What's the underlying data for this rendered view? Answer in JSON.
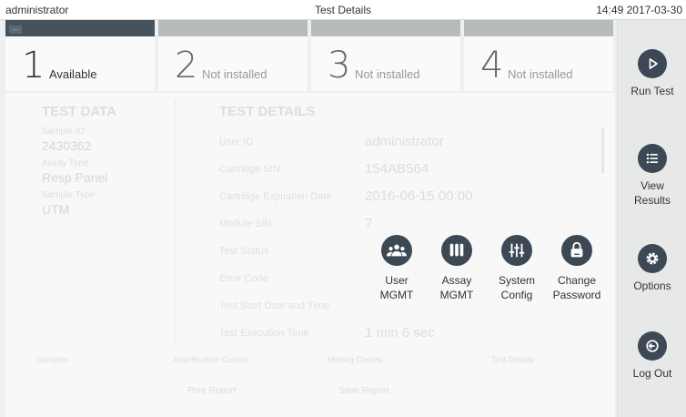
{
  "topbar": {
    "user": "administrator",
    "title": "Test Details",
    "datetime": "14:49 2017-03-30"
  },
  "modules": [
    {
      "number": "1",
      "label": "Available",
      "active": true
    },
    {
      "number": "2",
      "label": "Not installed",
      "active": false
    },
    {
      "number": "3",
      "label": "Not installed",
      "active": false
    },
    {
      "number": "4",
      "label": "Not installed",
      "active": false
    }
  ],
  "test_data": {
    "heading": "TEST DATA",
    "fields": [
      {
        "key": "Sample ID",
        "value": "2430362"
      },
      {
        "key": "Assay Type",
        "value": "Resp Panel"
      },
      {
        "key": "Sample Type",
        "value": "UTM"
      }
    ]
  },
  "test_details": {
    "heading": "TEST DETAILS",
    "rows": [
      {
        "key": "User ID",
        "value": "administrator"
      },
      {
        "key": "Cartridge S/N",
        "value": "154AB564"
      },
      {
        "key": "Cartridge Expiration Date",
        "value": "2016-06-15 00:00"
      },
      {
        "key": "Module S/N",
        "value": "7"
      },
      {
        "key": "Test Status",
        "value": ""
      },
      {
        "key": "Error Code",
        "value": ""
      },
      {
        "key": "Test Start Date and Time",
        "value": ""
      },
      {
        "key": "Test Execution Time",
        "value": "1 min 6 sec"
      }
    ]
  },
  "tabs": [
    "Samples",
    "Amplification Curves",
    "Melting Curves",
    "Test Details"
  ],
  "footer": {
    "print": "Print Report",
    "save": "Save Report"
  },
  "menu": {
    "user_mgmt": [
      "User",
      "MGMT"
    ],
    "assay_mgmt": [
      "Assay",
      "MGMT"
    ],
    "system_config": [
      "System",
      "Config"
    ],
    "change_password": [
      "Change",
      "Password"
    ]
  },
  "sidebar": {
    "run_test": [
      "Run Test"
    ],
    "view_results": [
      "View",
      "Results"
    ],
    "options": [
      "Options"
    ],
    "log_out": [
      "Log Out"
    ]
  },
  "colors": {
    "accent": "#3c4854",
    "active_tab": "#46535d",
    "inactive_tab": "#b5bcbb"
  }
}
